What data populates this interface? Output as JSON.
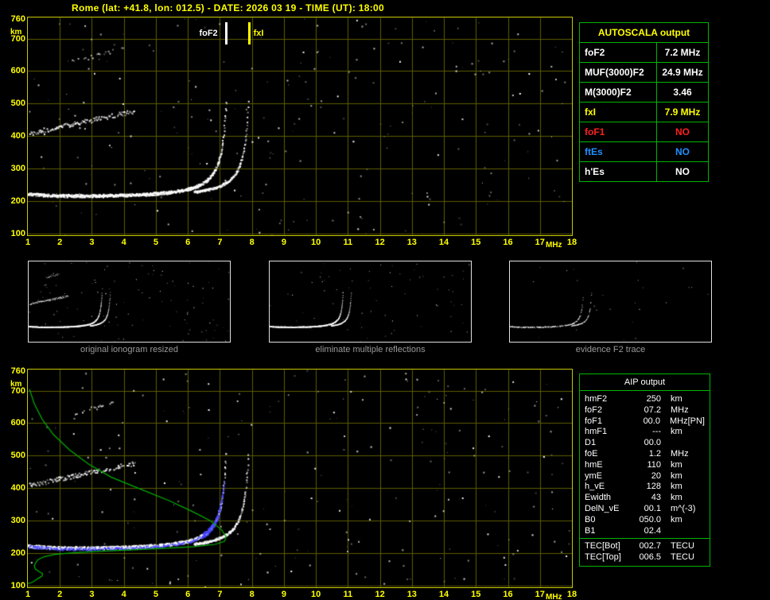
{
  "title": "Rome (lat: +41.8, lon: 012.5) - DATE: 2026 03 19 - TIME (UT): 18:00",
  "colors": {
    "accent_yellow": "#ffff00",
    "table_border_green": "#00b400",
    "profile_green": "#00b000",
    "trace_white": "#ffffff",
    "trace_blue": "#4040ff",
    "grid_olive": "#5c5c00",
    "caption_gray": "#9a9a9a",
    "alert_red": "#ff2020",
    "info_blue": "#2090ff"
  },
  "top_plot": {
    "y_unit": "km",
    "x_unit": "MHz",
    "y_ticks": [
      760,
      700,
      600,
      500,
      400,
      300,
      200,
      100
    ],
    "x_ticks": [
      1,
      2,
      3,
      4,
      5,
      6,
      7,
      8,
      9,
      10,
      11,
      12,
      13,
      14,
      15,
      16,
      17,
      18
    ],
    "markers": {
      "foF2_label": "foF2",
      "foF2_mhz": 7.2,
      "fxI_label": "fxI",
      "fxI_mhz": 7.9
    }
  },
  "bottom_plot": {
    "y_unit": "km",
    "x_unit": "MHz",
    "y_ticks": [
      760,
      700,
      600,
      500,
      400,
      300,
      200,
      100
    ],
    "x_ticks": [
      1,
      2,
      3,
      4,
      5,
      6,
      7,
      8,
      9,
      10,
      11,
      12,
      13,
      14,
      15,
      16,
      17,
      18
    ]
  },
  "autoscala_table": {
    "title": "AUTOSCALA output",
    "rows": [
      {
        "param": "foF2",
        "value": "7.2 MHz",
        "color": "#ffffff"
      },
      {
        "param": "MUF(3000)F2",
        "value": "24.9 MHz",
        "color": "#ffffff"
      },
      {
        "param": "M(3000)F2",
        "value": "3.46",
        "color": "#ffffff"
      },
      {
        "param": "fxI",
        "value": "7.9 MHz",
        "color": "#ffff00"
      },
      {
        "param": "foF1",
        "value": "NO",
        "color": "#ff2020"
      },
      {
        "param": "ftEs",
        "value": "NO",
        "color": "#2090ff"
      },
      {
        "param": "h'Es",
        "value": "NO",
        "color": "#ffffff"
      }
    ]
  },
  "thumbnails": [
    {
      "caption": "original ionogram resized"
    },
    {
      "caption": "eliminate multiple reflections"
    },
    {
      "caption": "evidence F2 trace"
    }
  ],
  "aip_table": {
    "title": "AIP output",
    "rows": [
      {
        "param": "hmF2",
        "value": "250",
        "unit": "km",
        "note": ""
      },
      {
        "param": "foF2",
        "value": "07.2",
        "unit": "MHz",
        "note": ""
      },
      {
        "param": "foF1",
        "value": "00.0",
        "unit": "MHz",
        "note": "[PN]"
      },
      {
        "param": "hmF1",
        "value": "---",
        "unit": "km",
        "note": ""
      },
      {
        "param": "D1",
        "value": "00.0",
        "unit": "",
        "note": ""
      },
      {
        "param": "foE",
        "value": "1.2",
        "unit": "MHz",
        "note": ""
      },
      {
        "param": "hmE",
        "value": "110",
        "unit": "km",
        "note": ""
      },
      {
        "param": "ymE",
        "value": "20",
        "unit": "km",
        "note": ""
      },
      {
        "param": "h_vE",
        "value": "128",
        "unit": "km",
        "note": ""
      },
      {
        "param": "Ewidth",
        "value": "43",
        "unit": "km",
        "note": ""
      },
      {
        "param": "DelN_vE",
        "value": "00.1",
        "unit": "m^(-3)",
        "note": ""
      },
      {
        "param": "B0",
        "value": "050.0",
        "unit": "km",
        "note": ""
      },
      {
        "param": "B1",
        "value": "02.4",
        "unit": "",
        "note": ""
      }
    ],
    "tec_rows": [
      {
        "param": "TEC[Bot]",
        "value": "002.7",
        "unit": "TECU"
      },
      {
        "param": "TEC[Top]",
        "value": "006.5",
        "unit": "TECU"
      }
    ]
  },
  "chart_data": {
    "type": "scatter",
    "title": "Rome ionogram 2026-03-19 18:00 UT",
    "xlabel": "MHz",
    "ylabel": "km",
    "xlim": [
      1,
      18
    ],
    "ylim": [
      95,
      765
    ],
    "grid": true,
    "scaled_parameters": {
      "foF2_MHz": 7.2,
      "MUF3000F2_MHz": 24.9,
      "M3000F2": 3.46,
      "fxI_MHz": 7.9,
      "hmF2_km": 250,
      "foF1_MHz": 0.0,
      "foE_MHz": 1.2,
      "hmE_km": 110,
      "ymE_km": 20,
      "h_vE_km": 128,
      "Ewidth_km": 43,
      "B0_km": 50.0,
      "B1": 2.4,
      "TEC_bot_TECU": 2.7,
      "TEC_top_TECU": 6.5
    },
    "traces": {
      "o_mode": {
        "base": 200,
        "a": 15,
        "b": 45,
        "fc": 7.35,
        "f_start": 1.02,
        "f_end": 7.22
      },
      "x_mode": {
        "base": 200,
        "a": 15,
        "b": 45,
        "fc": 8.05,
        "shift": 0.55,
        "f_start": 6.2,
        "f_end": 7.98
      },
      "second_hop": {
        "f_start": 1.05,
        "f_end": 4.35,
        "km_start": 408,
        "km_end": 476
      },
      "third_hop": {
        "f_start": 2.4,
        "f_end": 3.7,
        "km_start": 628,
        "km_end": 662
      }
    },
    "electron_density_profile": [
      [
        1.05,
        705
      ],
      [
        1.2,
        660
      ],
      [
        1.45,
        612
      ],
      [
        1.8,
        565
      ],
      [
        2.3,
        518
      ],
      [
        2.9,
        474
      ],
      [
        3.6,
        434
      ],
      [
        4.5,
        398
      ],
      [
        5.4,
        362
      ],
      [
        6.1,
        330
      ],
      [
        6.7,
        300
      ],
      [
        7.05,
        272
      ],
      [
        7.2,
        250
      ],
      [
        7.14,
        236
      ],
      [
        6.85,
        227
      ],
      [
        6.2,
        220
      ],
      [
        5.3,
        215
      ],
      [
        4.3,
        210
      ],
      [
        3.3,
        206
      ],
      [
        2.4,
        201
      ],
      [
        1.85,
        196
      ],
      [
        1.5,
        189
      ],
      [
        1.32,
        180
      ],
      [
        1.24,
        170
      ],
      [
        1.2,
        160
      ],
      [
        1.24,
        151
      ],
      [
        1.34,
        144
      ],
      [
        1.46,
        137
      ],
      [
        1.44,
        129
      ],
      [
        1.3,
        121
      ],
      [
        1.2,
        114
      ],
      [
        1.1,
        109
      ],
      [
        1.0,
        106
      ]
    ]
  }
}
